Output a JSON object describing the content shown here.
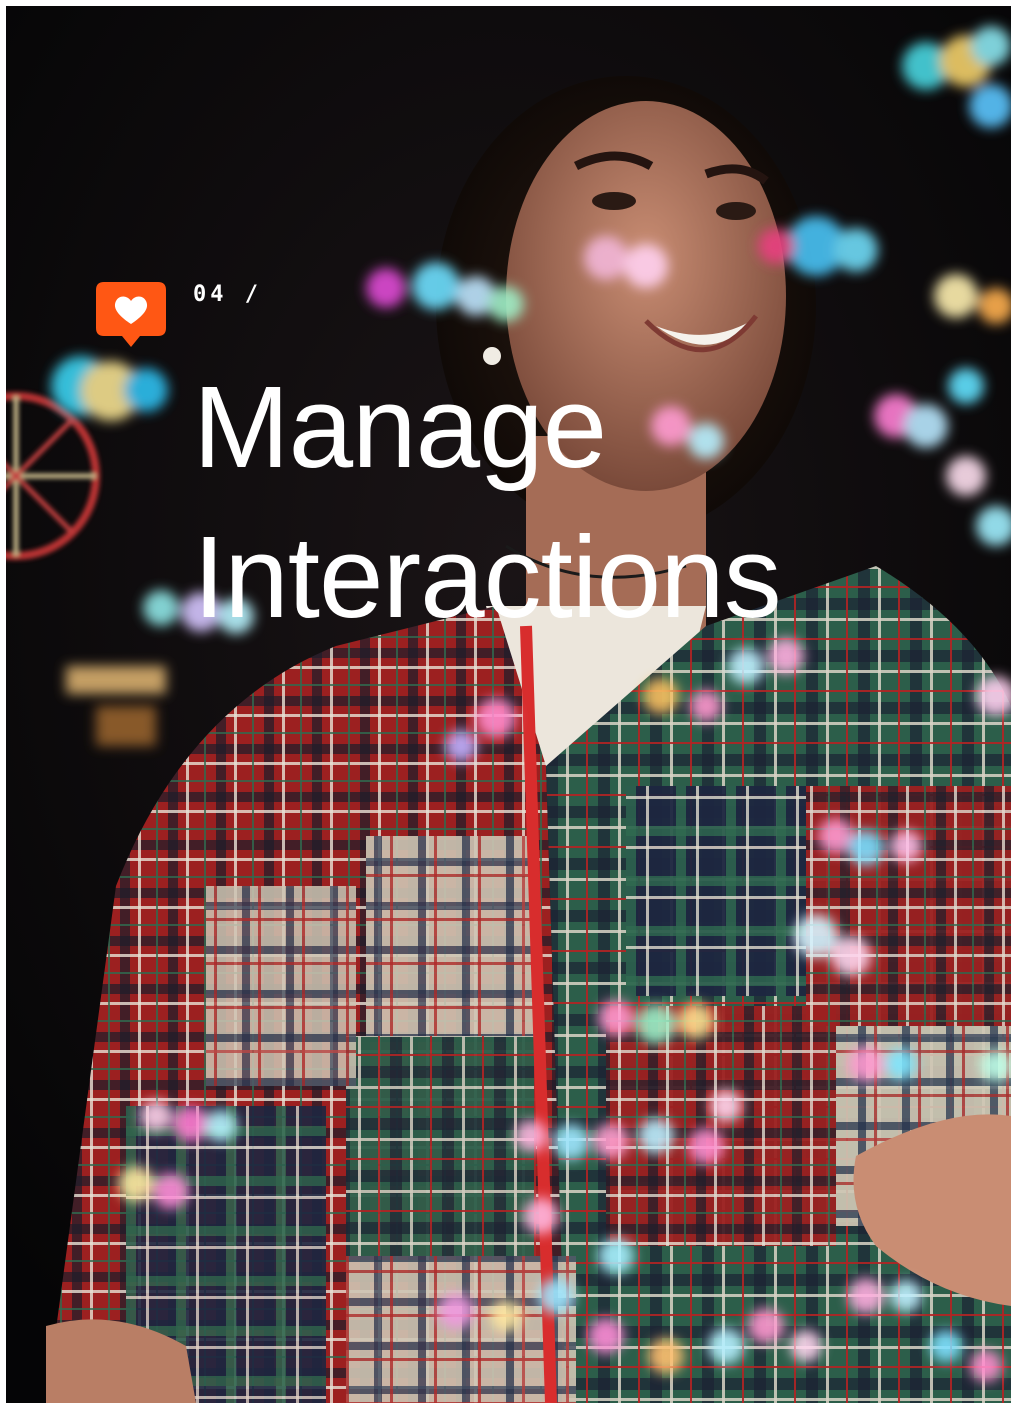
{
  "section": {
    "icon": "heart-notification-icon",
    "icon_color": "#ff5714",
    "number": "04 /"
  },
  "title": {
    "line1": "Manage",
    "line2": "Interactions"
  },
  "photo": {
    "subject": "person-in-plaid-jacket-with-bubbles"
  }
}
